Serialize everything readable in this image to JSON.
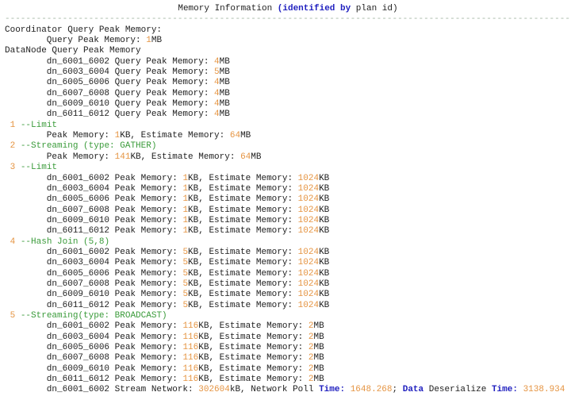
{
  "colors": {
    "plain": "#1e1e1e",
    "num": "#e59442",
    "op": "#3a9b3a",
    "kw": "#1f1fbf",
    "sep": "#a5b7a5"
  },
  "console": {
    "lines": [
      {
        "name": "title-line",
        "align": "center",
        "segments": [
          {
            "t": "Memory Information ",
            "c": "plain"
          },
          {
            "t": "(identified by",
            "c": "kw"
          },
          {
            "t": " plan id)",
            "c": "plain"
          }
        ]
      },
      {
        "name": "separator-line",
        "segments": [
          {
            "t": "-------------------------------------------------------------------------------------------------------------------",
            "c": "sep"
          }
        ]
      },
      {
        "name": "coordinator-peak-header",
        "segments": [
          {
            "t": "Coordinator Query Peak Memory:",
            "c": "plain"
          }
        ]
      },
      {
        "name": "coordinator-peak-value",
        "segments": [
          {
            "t": "        Query Peak Memory: ",
            "c": "plain"
          },
          {
            "t": "1",
            "c": "num"
          },
          {
            "t": "MB",
            "c": "plain"
          }
        ]
      },
      {
        "name": "datanode-peak-header",
        "segments": [
          {
            "t": "DataNode Query Peak Memory",
            "c": "plain"
          }
        ]
      },
      {
        "name": "datanode-peak-row",
        "segments": [
          {
            "t": "        dn_6001_6002 Query Peak Memory: ",
            "c": "plain"
          },
          {
            "t": "4",
            "c": "num"
          },
          {
            "t": "MB",
            "c": "plain"
          }
        ]
      },
      {
        "name": "datanode-peak-row",
        "segments": [
          {
            "t": "        dn_6003_6004 Query Peak Memory: ",
            "c": "plain"
          },
          {
            "t": "5",
            "c": "num"
          },
          {
            "t": "MB",
            "c": "plain"
          }
        ]
      },
      {
        "name": "datanode-peak-row",
        "segments": [
          {
            "t": "        dn_6005_6006 Query Peak Memory: ",
            "c": "plain"
          },
          {
            "t": "4",
            "c": "num"
          },
          {
            "t": "MB",
            "c": "plain"
          }
        ]
      },
      {
        "name": "datanode-peak-row",
        "segments": [
          {
            "t": "        dn_6007_6008 Query Peak Memory: ",
            "c": "plain"
          },
          {
            "t": "4",
            "c": "num"
          },
          {
            "t": "MB",
            "c": "plain"
          }
        ]
      },
      {
        "name": "datanode-peak-row",
        "segments": [
          {
            "t": "        dn_6009_6010 Query Peak Memory: ",
            "c": "plain"
          },
          {
            "t": "4",
            "c": "num"
          },
          {
            "t": "MB",
            "c": "plain"
          }
        ]
      },
      {
        "name": "datanode-peak-row",
        "segments": [
          {
            "t": "        dn_6011_6012 Query Peak Memory: ",
            "c": "plain"
          },
          {
            "t": "4",
            "c": "num"
          },
          {
            "t": "MB",
            "c": "plain"
          }
        ]
      },
      {
        "name": "plan-node-header",
        "segments": [
          {
            "t": " ",
            "c": "plain"
          },
          {
            "t": "1",
            "c": "num"
          },
          {
            "t": " ",
            "c": "plain"
          },
          {
            "t": "--Limit",
            "c": "op"
          }
        ]
      },
      {
        "name": "plan-node-memory-row",
        "segments": [
          {
            "t": "        Peak Memory: ",
            "c": "plain"
          },
          {
            "t": "1",
            "c": "num"
          },
          {
            "t": "KB, Estimate Memory: ",
            "c": "plain"
          },
          {
            "t": "64",
            "c": "num"
          },
          {
            "t": "MB",
            "c": "plain"
          }
        ]
      },
      {
        "name": "plan-node-header",
        "segments": [
          {
            "t": " ",
            "c": "plain"
          },
          {
            "t": "2",
            "c": "num"
          },
          {
            "t": " ",
            "c": "plain"
          },
          {
            "t": "--Streaming (type: GATHER)",
            "c": "op"
          }
        ]
      },
      {
        "name": "plan-node-memory-row",
        "segments": [
          {
            "t": "        Peak Memory: ",
            "c": "plain"
          },
          {
            "t": "141",
            "c": "num"
          },
          {
            "t": "KB, Estimate Memory: ",
            "c": "plain"
          },
          {
            "t": "64",
            "c": "num"
          },
          {
            "t": "MB",
            "c": "plain"
          }
        ]
      },
      {
        "name": "plan-node-header",
        "segments": [
          {
            "t": " ",
            "c": "plain"
          },
          {
            "t": "3",
            "c": "num"
          },
          {
            "t": " ",
            "c": "plain"
          },
          {
            "t": "--Limit",
            "c": "op"
          }
        ]
      },
      {
        "name": "plan-node-memory-row",
        "segments": [
          {
            "t": "        dn_6001_6002 Peak Memory: ",
            "c": "plain"
          },
          {
            "t": "1",
            "c": "num"
          },
          {
            "t": "KB, Estimate Memory: ",
            "c": "plain"
          },
          {
            "t": "1024",
            "c": "num"
          },
          {
            "t": "KB",
            "c": "plain"
          }
        ]
      },
      {
        "name": "plan-node-memory-row",
        "segments": [
          {
            "t": "        dn_6003_6004 Peak Memory: ",
            "c": "plain"
          },
          {
            "t": "1",
            "c": "num"
          },
          {
            "t": "KB, Estimate Memory: ",
            "c": "plain"
          },
          {
            "t": "1024",
            "c": "num"
          },
          {
            "t": "KB",
            "c": "plain"
          }
        ]
      },
      {
        "name": "plan-node-memory-row",
        "segments": [
          {
            "t": "        dn_6005_6006 Peak Memory: ",
            "c": "plain"
          },
          {
            "t": "1",
            "c": "num"
          },
          {
            "t": "KB, Estimate Memory: ",
            "c": "plain"
          },
          {
            "t": "1024",
            "c": "num"
          },
          {
            "t": "KB",
            "c": "plain"
          }
        ]
      },
      {
        "name": "plan-node-memory-row",
        "segments": [
          {
            "t": "        dn_6007_6008 Peak Memory: ",
            "c": "plain"
          },
          {
            "t": "1",
            "c": "num"
          },
          {
            "t": "KB, Estimate Memory: ",
            "c": "plain"
          },
          {
            "t": "1024",
            "c": "num"
          },
          {
            "t": "KB",
            "c": "plain"
          }
        ]
      },
      {
        "name": "plan-node-memory-row",
        "segments": [
          {
            "t": "        dn_6009_6010 Peak Memory: ",
            "c": "plain"
          },
          {
            "t": "1",
            "c": "num"
          },
          {
            "t": "KB, Estimate Memory: ",
            "c": "plain"
          },
          {
            "t": "1024",
            "c": "num"
          },
          {
            "t": "KB",
            "c": "plain"
          }
        ]
      },
      {
        "name": "plan-node-memory-row",
        "segments": [
          {
            "t": "        dn_6011_6012 Peak Memory: ",
            "c": "plain"
          },
          {
            "t": "1",
            "c": "num"
          },
          {
            "t": "KB, Estimate Memory: ",
            "c": "plain"
          },
          {
            "t": "1024",
            "c": "num"
          },
          {
            "t": "KB",
            "c": "plain"
          }
        ]
      },
      {
        "name": "plan-node-header",
        "segments": [
          {
            "t": " ",
            "c": "plain"
          },
          {
            "t": "4",
            "c": "num"
          },
          {
            "t": " ",
            "c": "plain"
          },
          {
            "t": "--Hash Join (5,8)",
            "c": "op"
          }
        ]
      },
      {
        "name": "plan-node-memory-row",
        "segments": [
          {
            "t": "        dn_6001_6002 Peak Memory: ",
            "c": "plain"
          },
          {
            "t": "5",
            "c": "num"
          },
          {
            "t": "KB, Estimate Memory: ",
            "c": "plain"
          },
          {
            "t": "1024",
            "c": "num"
          },
          {
            "t": "KB",
            "c": "plain"
          }
        ]
      },
      {
        "name": "plan-node-memory-row",
        "segments": [
          {
            "t": "        dn_6003_6004 Peak Memory: ",
            "c": "plain"
          },
          {
            "t": "5",
            "c": "num"
          },
          {
            "t": "KB, Estimate Memory: ",
            "c": "plain"
          },
          {
            "t": "1024",
            "c": "num"
          },
          {
            "t": "KB",
            "c": "plain"
          }
        ]
      },
      {
        "name": "plan-node-memory-row",
        "segments": [
          {
            "t": "        dn_6005_6006 Peak Memory: ",
            "c": "plain"
          },
          {
            "t": "5",
            "c": "num"
          },
          {
            "t": "KB, Estimate Memory: ",
            "c": "plain"
          },
          {
            "t": "1024",
            "c": "num"
          },
          {
            "t": "KB",
            "c": "plain"
          }
        ]
      },
      {
        "name": "plan-node-memory-row",
        "segments": [
          {
            "t": "        dn_6007_6008 Peak Memory: ",
            "c": "plain"
          },
          {
            "t": "5",
            "c": "num"
          },
          {
            "t": "KB, Estimate Memory: ",
            "c": "plain"
          },
          {
            "t": "1024",
            "c": "num"
          },
          {
            "t": "KB",
            "c": "plain"
          }
        ]
      },
      {
        "name": "plan-node-memory-row",
        "segments": [
          {
            "t": "        dn_6009_6010 Peak Memory: ",
            "c": "plain"
          },
          {
            "t": "5",
            "c": "num"
          },
          {
            "t": "KB, Estimate Memory: ",
            "c": "plain"
          },
          {
            "t": "1024",
            "c": "num"
          },
          {
            "t": "KB",
            "c": "plain"
          }
        ]
      },
      {
        "name": "plan-node-memory-row",
        "segments": [
          {
            "t": "        dn_6011_6012 Peak Memory: ",
            "c": "plain"
          },
          {
            "t": "5",
            "c": "num"
          },
          {
            "t": "KB, Estimate Memory: ",
            "c": "plain"
          },
          {
            "t": "1024",
            "c": "num"
          },
          {
            "t": "KB",
            "c": "plain"
          }
        ]
      },
      {
        "name": "plan-node-header",
        "segments": [
          {
            "t": " ",
            "c": "plain"
          },
          {
            "t": "5",
            "c": "num"
          },
          {
            "t": " ",
            "c": "plain"
          },
          {
            "t": "--Streaming(type: BROADCAST)",
            "c": "op"
          }
        ]
      },
      {
        "name": "plan-node-memory-row",
        "segments": [
          {
            "t": "        dn_6001_6002 Peak Memory: ",
            "c": "plain"
          },
          {
            "t": "116",
            "c": "num"
          },
          {
            "t": "KB, Estimate Memory: ",
            "c": "plain"
          },
          {
            "t": "2",
            "c": "num"
          },
          {
            "t": "MB",
            "c": "plain"
          }
        ]
      },
      {
        "name": "plan-node-memory-row",
        "segments": [
          {
            "t": "        dn_6003_6004 Peak Memory: ",
            "c": "plain"
          },
          {
            "t": "116",
            "c": "num"
          },
          {
            "t": "KB, Estimate Memory: ",
            "c": "plain"
          },
          {
            "t": "2",
            "c": "num"
          },
          {
            "t": "MB",
            "c": "plain"
          }
        ]
      },
      {
        "name": "plan-node-memory-row",
        "segments": [
          {
            "t": "        dn_6005_6006 Peak Memory: ",
            "c": "plain"
          },
          {
            "t": "116",
            "c": "num"
          },
          {
            "t": "KB, Estimate Memory: ",
            "c": "plain"
          },
          {
            "t": "2",
            "c": "num"
          },
          {
            "t": "MB",
            "c": "plain"
          }
        ]
      },
      {
        "name": "plan-node-memory-row",
        "segments": [
          {
            "t": "        dn_6007_6008 Peak Memory: ",
            "c": "plain"
          },
          {
            "t": "116",
            "c": "num"
          },
          {
            "t": "KB, Estimate Memory: ",
            "c": "plain"
          },
          {
            "t": "2",
            "c": "num"
          },
          {
            "t": "MB",
            "c": "plain"
          }
        ]
      },
      {
        "name": "plan-node-memory-row",
        "segments": [
          {
            "t": "        dn_6009_6010 Peak Memory: ",
            "c": "plain"
          },
          {
            "t": "116",
            "c": "num"
          },
          {
            "t": "KB, Estimate Memory: ",
            "c": "plain"
          },
          {
            "t": "2",
            "c": "num"
          },
          {
            "t": "MB",
            "c": "plain"
          }
        ]
      },
      {
        "name": "plan-node-memory-row",
        "segments": [
          {
            "t": "        dn_6011_6012 Peak Memory: ",
            "c": "plain"
          },
          {
            "t": "116",
            "c": "num"
          },
          {
            "t": "KB, Estimate Memory: ",
            "c": "plain"
          },
          {
            "t": "2",
            "c": "num"
          },
          {
            "t": "MB",
            "c": "plain"
          }
        ]
      },
      {
        "name": "stream-network-row",
        "segments": [
          {
            "t": "        dn_6001_6002 Stream Network: ",
            "c": "plain"
          },
          {
            "t": "302604",
            "c": "num"
          },
          {
            "t": "kB, Network Poll ",
            "c": "plain"
          },
          {
            "t": "Time:",
            "c": "kw"
          },
          {
            "t": " ",
            "c": "plain"
          },
          {
            "t": "1648.268",
            "c": "num"
          },
          {
            "t": "; ",
            "c": "plain"
          },
          {
            "t": "Data",
            "c": "kw"
          },
          {
            "t": " Deserialize ",
            "c": "plain"
          },
          {
            "t": "Time:",
            "c": "kw"
          },
          {
            "t": " ",
            "c": "plain"
          },
          {
            "t": "3138.934",
            "c": "num"
          }
        ]
      }
    ]
  }
}
